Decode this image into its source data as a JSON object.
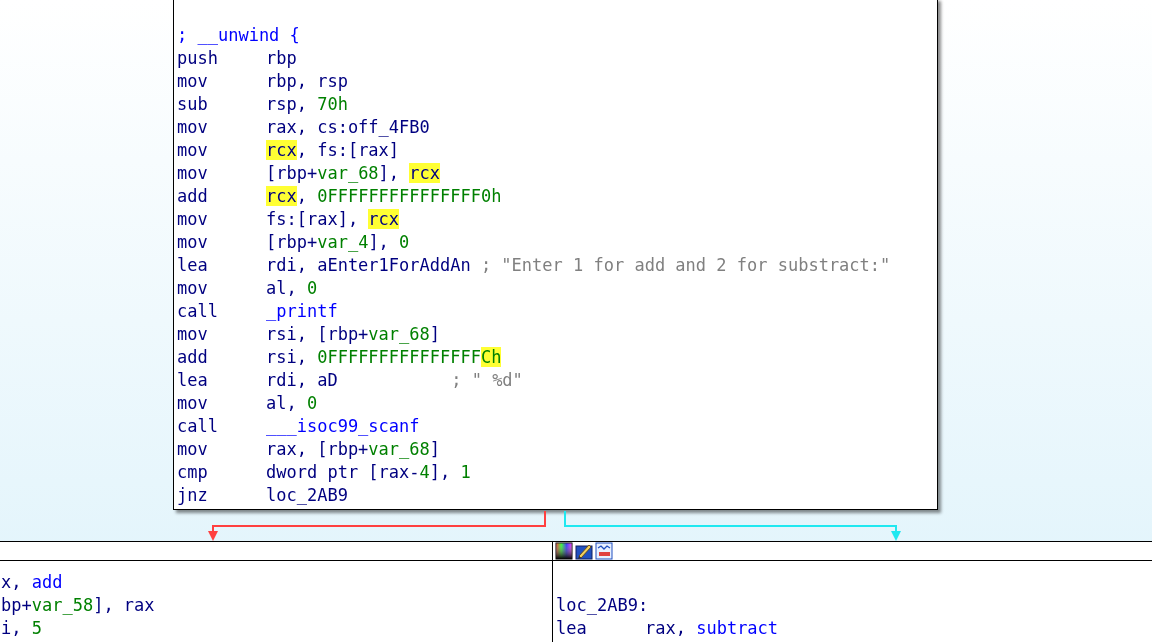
{
  "blocks": [
    {
      "kind": "main",
      "lines": [
        {
          "kind": "directive",
          "text": "; __unwind {"
        },
        {
          "kind": "instruction",
          "mnemonic": "push",
          "operands": [
            {
              "text": "rbp",
              "kind": "plain",
              "highlighted": false
            }
          ]
        },
        {
          "kind": "instruction",
          "mnemonic": "mov",
          "operands": [
            {
              "text": "rbp, rsp",
              "kind": "plain",
              "highlighted": false
            }
          ]
        },
        {
          "kind": "instruction",
          "mnemonic": "sub",
          "operands": [
            {
              "text": "rsp, ",
              "kind": "plain",
              "highlighted": false
            },
            {
              "text": "70h",
              "kind": "number",
              "highlighted": false
            }
          ]
        },
        {
          "kind": "instruction",
          "mnemonic": "mov",
          "operands": [
            {
              "text": "rax, cs:off_4FB0",
              "kind": "plain",
              "highlighted": false
            }
          ]
        },
        {
          "kind": "instruction",
          "mnemonic": "mov",
          "operands": [
            {
              "text": "rcx",
              "kind": "plain",
              "highlighted": true
            },
            {
              "text": ", fs:[rax]",
              "kind": "plain",
              "highlighted": false
            }
          ]
        },
        {
          "kind": "instruction",
          "mnemonic": "mov",
          "operands": [
            {
              "text": "[rbp+",
              "kind": "plain",
              "highlighted": false
            },
            {
              "text": "var_68",
              "kind": "number",
              "highlighted": false
            },
            {
              "text": "], ",
              "kind": "plain",
              "highlighted": false
            },
            {
              "text": "rcx",
              "kind": "plain",
              "highlighted": true
            }
          ]
        },
        {
          "kind": "instruction",
          "mnemonic": "add",
          "operands": [
            {
              "text": "rcx",
              "kind": "plain",
              "highlighted": true
            },
            {
              "text": ", ",
              "kind": "plain",
              "highlighted": false
            },
            {
              "text": "0FFFFFFFFFFFFFFF0h",
              "kind": "number",
              "highlighted": false
            }
          ]
        },
        {
          "kind": "instruction",
          "mnemonic": "mov",
          "operands": [
            {
              "text": "fs:[rax], ",
              "kind": "plain",
              "highlighted": false
            },
            {
              "text": "rcx",
              "kind": "plain",
              "highlighted": true
            }
          ]
        },
        {
          "kind": "instruction",
          "mnemonic": "mov",
          "operands": [
            {
              "text": "[rbp+",
              "kind": "plain",
              "highlighted": false
            },
            {
              "text": "var_4",
              "kind": "number",
              "highlighted": false
            },
            {
              "text": "], ",
              "kind": "plain",
              "highlighted": false
            },
            {
              "text": "0",
              "kind": "number",
              "highlighted": false
            }
          ]
        },
        {
          "kind": "instruction",
          "mnemonic": "lea",
          "operands": [
            {
              "text": "rdi, aEnter1ForAddAn",
              "kind": "plain",
              "highlighted": false
            }
          ],
          "comment": "; \"Enter 1 for add and 2 for substract:\""
        },
        {
          "kind": "instruction",
          "mnemonic": "mov",
          "operands": [
            {
              "text": "al, ",
              "kind": "plain",
              "highlighted": false
            },
            {
              "text": "0",
              "kind": "number",
              "highlighted": false
            }
          ]
        },
        {
          "kind": "instruction",
          "mnemonic": "call",
          "operands": [
            {
              "text": "_printf",
              "kind": "name",
              "highlighted": false
            }
          ]
        },
        {
          "kind": "instruction",
          "mnemonic": "mov",
          "operands": [
            {
              "text": "rsi, [rbp+",
              "kind": "plain",
              "highlighted": false
            },
            {
              "text": "var_68",
              "kind": "number",
              "highlighted": false
            },
            {
              "text": "]",
              "kind": "plain",
              "highlighted": false
            }
          ]
        },
        {
          "kind": "instruction",
          "mnemonic": "add",
          "operands": [
            {
              "text": "rsi, ",
              "kind": "plain",
              "highlighted": false
            },
            {
              "text": "0FFFFFFFFFFFFFFF",
              "kind": "number",
              "highlighted": false
            },
            {
              "text": "Ch",
              "kind": "number",
              "highlighted": true
            }
          ]
        },
        {
          "kind": "instruction",
          "mnemonic": "lea",
          "operands": [
            {
              "text": "rdi, aD",
              "kind": "plain",
              "highlighted": false
            }
          ],
          "comment": "; \" %d\""
        },
        {
          "kind": "instruction",
          "mnemonic": "mov",
          "operands": [
            {
              "text": "al, ",
              "kind": "plain",
              "highlighted": false
            },
            {
              "text": "0",
              "kind": "number",
              "highlighted": false
            }
          ]
        },
        {
          "kind": "instruction",
          "mnemonic": "call",
          "operands": [
            {
              "text": "___isoc99_scanf",
              "kind": "name",
              "highlighted": false
            }
          ]
        },
        {
          "kind": "instruction",
          "mnemonic": "mov",
          "operands": [
            {
              "text": "rax, [rbp+",
              "kind": "plain",
              "highlighted": false
            },
            {
              "text": "var_68",
              "kind": "number",
              "highlighted": false
            },
            {
              "text": "]",
              "kind": "plain",
              "highlighted": false
            }
          ]
        },
        {
          "kind": "instruction",
          "mnemonic": "cmp",
          "operands": [
            {
              "text": "dword ptr [rax-",
              "kind": "plain",
              "highlighted": false
            },
            {
              "text": "4",
              "kind": "number",
              "highlighted": false
            },
            {
              "text": "], ",
              "kind": "plain",
              "highlighted": false
            },
            {
              "text": "1",
              "kind": "number",
              "highlighted": false
            }
          ]
        },
        {
          "kind": "instruction",
          "mnemonic": "jnz",
          "operands": [
            {
              "text": "loc_2AB9",
              "kind": "plain",
              "highlighted": false
            }
          ]
        }
      ]
    },
    {
      "kind": "left",
      "lines": [
        {
          "kind": "fragment",
          "operands": [
            {
              "text": "x, ",
              "kind": "plain",
              "highlighted": false
            },
            {
              "text": "add",
              "kind": "name",
              "highlighted": false
            }
          ]
        },
        {
          "kind": "fragment",
          "operands": [
            {
              "text": "bp+",
              "kind": "plain",
              "highlighted": false
            },
            {
              "text": "var_58",
              "kind": "number",
              "highlighted": false
            },
            {
              "text": "], rax",
              "kind": "plain",
              "highlighted": false
            }
          ]
        },
        {
          "kind": "fragment",
          "operands": [
            {
              "text": "i, ",
              "kind": "plain",
              "highlighted": false
            },
            {
              "text": "5",
              "kind": "number",
              "highlighted": false
            }
          ]
        }
      ]
    },
    {
      "kind": "right",
      "lines": [
        {
          "kind": "blank"
        },
        {
          "kind": "label",
          "text": "loc_2AB9:"
        },
        {
          "kind": "instruction",
          "mnemonic": "lea",
          "operands": [
            {
              "text": "rax, ",
              "kind": "plain",
              "highlighted": false
            },
            {
              "text": "subtract",
              "kind": "name",
              "highlighted": false
            }
          ]
        }
      ]
    }
  ],
  "edges": [
    {
      "kind": "false_branch",
      "color": "#ff4040"
    },
    {
      "kind": "true_branch",
      "color": "#20e8f0"
    }
  ]
}
